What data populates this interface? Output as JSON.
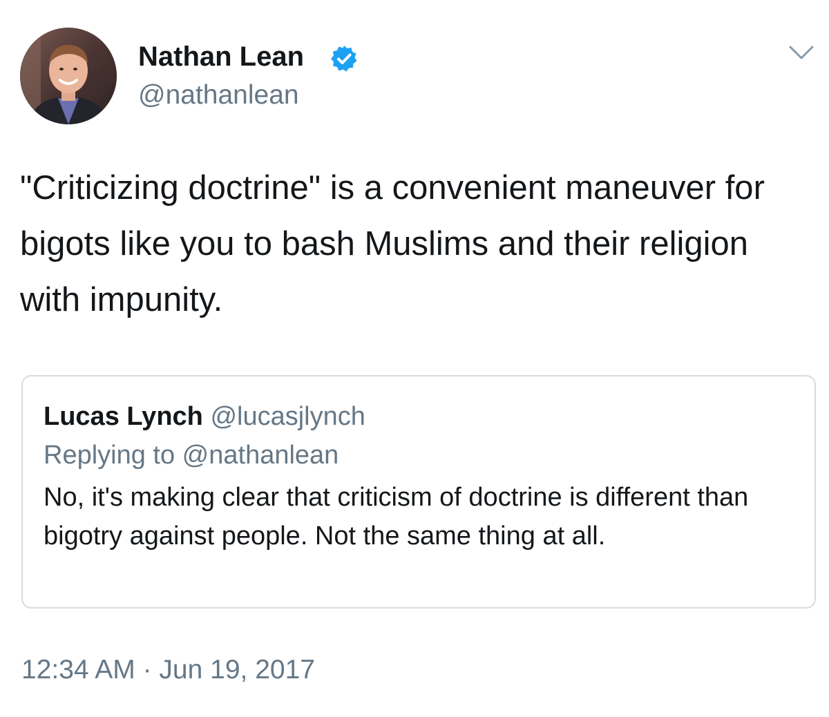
{
  "tweet": {
    "author": {
      "name": "Nathan Lean",
      "handle": "@nathanlean",
      "verified_icon": "verified-badge-icon",
      "avatar_icon": "profile-photo"
    },
    "menu_icon": "chevron-down-icon",
    "text": "\"Criticizing doctrine\" is a convenient maneuver for bigots like you to bash Muslims and their religion with impunity.",
    "quoted_tweet": {
      "name": "Lucas Lynch",
      "handle": "@lucasjlynch",
      "replying_to": "Replying to @nathanlean",
      "text": "No, it's making clear that criticism of doctrine is different than bigotry against people.  Not the same thing at all."
    },
    "timestamp": "12:34 AM · Jun 19, 2017"
  },
  "colors": {
    "primary_text": "#14171a",
    "secondary_text": "#657786",
    "verified_blue": "#1da1f2",
    "card_border": "#d5dce1"
  }
}
